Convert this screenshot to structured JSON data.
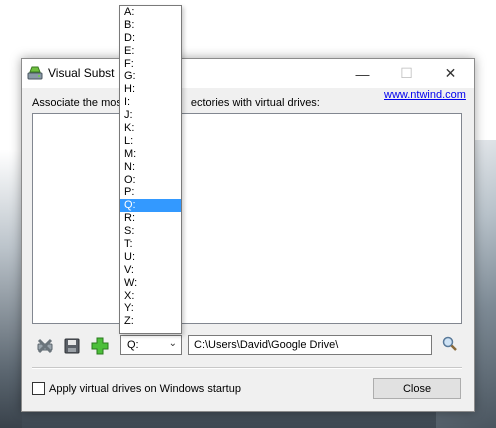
{
  "window": {
    "title": "Visual Subst",
    "description": "Associate the most frequently used directories with virtual drives:",
    "description_visible": "Associate the mos",
    "description_visible_tail": "ectories with virtual drives:",
    "link": "www.ntwind.com",
    "minimize_glyph": "—",
    "maximize_glyph": "☐",
    "close_glyph": "✕"
  },
  "toolbar": {
    "selected_drive": "Q:",
    "path_value": "C:\\Users\\David\\Google Drive\\",
    "chevron": "⌄"
  },
  "startup": {
    "label": "Apply virtual drives on Windows startup",
    "checked": false
  },
  "close_button": "Close",
  "dropdown": {
    "items": [
      "A:",
      "B:",
      "D:",
      "E:",
      "F:",
      "G:",
      "H:",
      "I:",
      "J:",
      "K:",
      "L:",
      "M:",
      "N:",
      "O:",
      "P:",
      "Q:",
      "R:",
      "S:",
      "T:",
      "U:",
      "V:",
      "W:",
      "X:",
      "Y:",
      "Z:"
    ],
    "selected": "Q:"
  },
  "icons": {
    "app": "drive-icon",
    "delete": "remove-drive-icon",
    "save": "save-icon",
    "add": "add-drive-icon",
    "browse": "browse-folder-icon"
  },
  "colors": {
    "selection": "#3399ff",
    "link": "#0000ee"
  }
}
